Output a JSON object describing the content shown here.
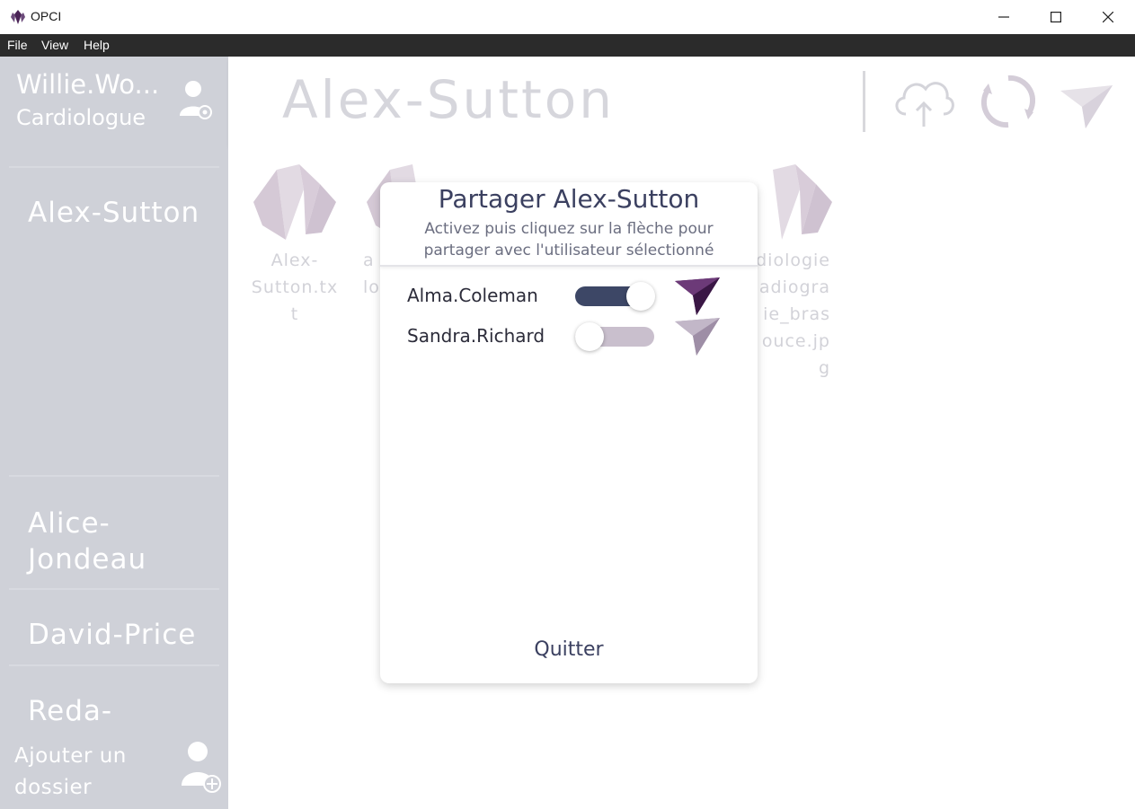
{
  "window": {
    "title": "OPCI"
  },
  "menu": [
    "File",
    "View",
    "Help"
  ],
  "user": {
    "name": "Willie.Wo...",
    "role": "Cardiologue",
    "icon": "user-settings-icon"
  },
  "sidebar": {
    "folders": [
      {
        "label": "Alex-Sutton"
      },
      {
        "label": "Alice-\nJondeau"
      },
      {
        "label": "David-Price"
      },
      {
        "label": "Reda-"
      }
    ],
    "add_label": "Ajouter un\ndossier",
    "add_icon": "user-add-icon"
  },
  "main": {
    "title": "Alex-Sutton",
    "icons": [
      "cloud-upload-icon",
      "refresh-icon",
      "send-icon"
    ],
    "files": [
      {
        "name": "Alex-\nSutton.txt"
      },
      {
        "name": "a\nlo"
      },
      {
        "name": ""
      },
      {
        "name": ""
      },
      {
        "name": "rdiologie\nadiogra\nie_bras\nouce.jp\ng"
      }
    ]
  },
  "dialog": {
    "title": "Partager Alex-Sutton",
    "subtitle": "Activez puis cliquez sur la flèche pour partager avec l'utilisateur sélectionné",
    "users": [
      {
        "name": "Alma.Coleman",
        "enabled": true
      },
      {
        "name": "Sandra.Richard",
        "enabled": false
      }
    ],
    "quit_label": "Quitter"
  },
  "colors": {
    "sidebar": "#cfd1d8",
    "menubar": "#2b2b2b",
    "accent_dark": "#3d4766",
    "send_active": "#4a2356",
    "send_inactive": "#9e8ea6",
    "toggle_off": "#c9bfcd"
  }
}
